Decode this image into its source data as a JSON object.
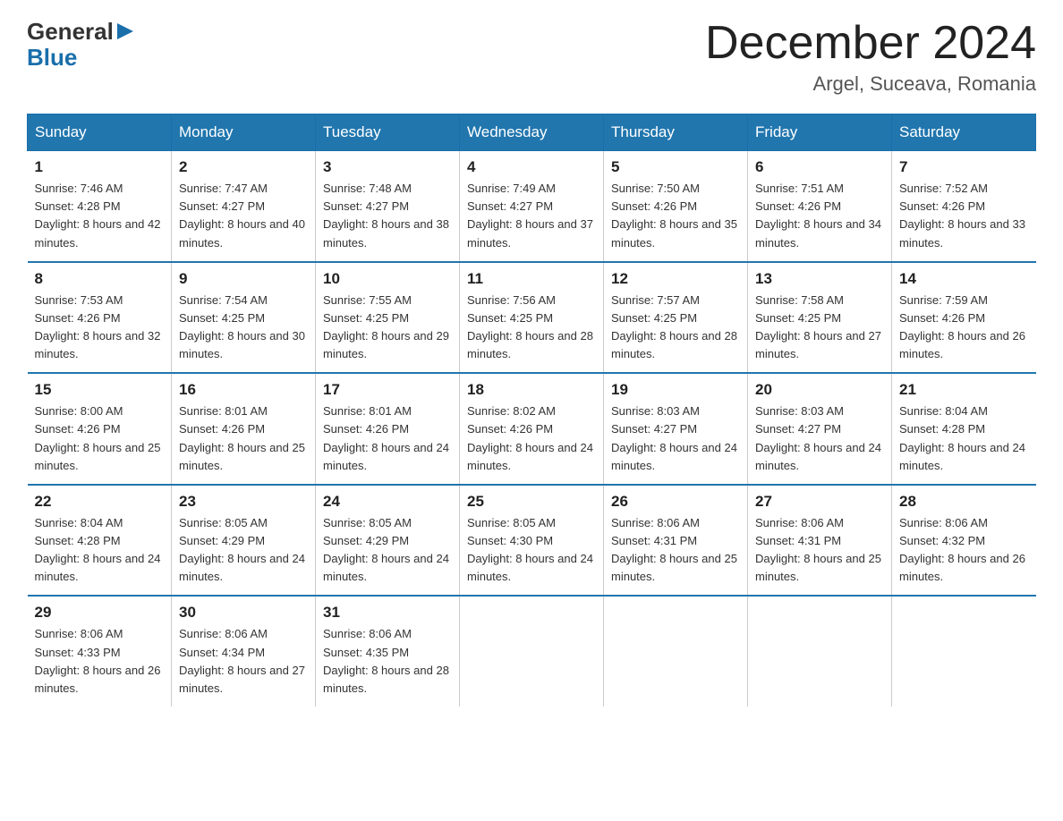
{
  "logo": {
    "line1": "General",
    "line2": "Blue"
  },
  "header": {
    "title": "December 2024",
    "location": "Argel, Suceava, Romania"
  },
  "days_of_week": [
    "Sunday",
    "Monday",
    "Tuesday",
    "Wednesday",
    "Thursday",
    "Friday",
    "Saturday"
  ],
  "weeks": [
    [
      {
        "day": "1",
        "sunrise": "7:46 AM",
        "sunset": "4:28 PM",
        "daylight": "8 hours and 42 minutes."
      },
      {
        "day": "2",
        "sunrise": "7:47 AM",
        "sunset": "4:27 PM",
        "daylight": "8 hours and 40 minutes."
      },
      {
        "day": "3",
        "sunrise": "7:48 AM",
        "sunset": "4:27 PM",
        "daylight": "8 hours and 38 minutes."
      },
      {
        "day": "4",
        "sunrise": "7:49 AM",
        "sunset": "4:27 PM",
        "daylight": "8 hours and 37 minutes."
      },
      {
        "day": "5",
        "sunrise": "7:50 AM",
        "sunset": "4:26 PM",
        "daylight": "8 hours and 35 minutes."
      },
      {
        "day": "6",
        "sunrise": "7:51 AM",
        "sunset": "4:26 PM",
        "daylight": "8 hours and 34 minutes."
      },
      {
        "day": "7",
        "sunrise": "7:52 AM",
        "sunset": "4:26 PM",
        "daylight": "8 hours and 33 minutes."
      }
    ],
    [
      {
        "day": "8",
        "sunrise": "7:53 AM",
        "sunset": "4:26 PM",
        "daylight": "8 hours and 32 minutes."
      },
      {
        "day": "9",
        "sunrise": "7:54 AM",
        "sunset": "4:25 PM",
        "daylight": "8 hours and 30 minutes."
      },
      {
        "day": "10",
        "sunrise": "7:55 AM",
        "sunset": "4:25 PM",
        "daylight": "8 hours and 29 minutes."
      },
      {
        "day": "11",
        "sunrise": "7:56 AM",
        "sunset": "4:25 PM",
        "daylight": "8 hours and 28 minutes."
      },
      {
        "day": "12",
        "sunrise": "7:57 AM",
        "sunset": "4:25 PM",
        "daylight": "8 hours and 28 minutes."
      },
      {
        "day": "13",
        "sunrise": "7:58 AM",
        "sunset": "4:25 PM",
        "daylight": "8 hours and 27 minutes."
      },
      {
        "day": "14",
        "sunrise": "7:59 AM",
        "sunset": "4:26 PM",
        "daylight": "8 hours and 26 minutes."
      }
    ],
    [
      {
        "day": "15",
        "sunrise": "8:00 AM",
        "sunset": "4:26 PM",
        "daylight": "8 hours and 25 minutes."
      },
      {
        "day": "16",
        "sunrise": "8:01 AM",
        "sunset": "4:26 PM",
        "daylight": "8 hours and 25 minutes."
      },
      {
        "day": "17",
        "sunrise": "8:01 AM",
        "sunset": "4:26 PM",
        "daylight": "8 hours and 24 minutes."
      },
      {
        "day": "18",
        "sunrise": "8:02 AM",
        "sunset": "4:26 PM",
        "daylight": "8 hours and 24 minutes."
      },
      {
        "day": "19",
        "sunrise": "8:03 AM",
        "sunset": "4:27 PM",
        "daylight": "8 hours and 24 minutes."
      },
      {
        "day": "20",
        "sunrise": "8:03 AM",
        "sunset": "4:27 PM",
        "daylight": "8 hours and 24 minutes."
      },
      {
        "day": "21",
        "sunrise": "8:04 AM",
        "sunset": "4:28 PM",
        "daylight": "8 hours and 24 minutes."
      }
    ],
    [
      {
        "day": "22",
        "sunrise": "8:04 AM",
        "sunset": "4:28 PM",
        "daylight": "8 hours and 24 minutes."
      },
      {
        "day": "23",
        "sunrise": "8:05 AM",
        "sunset": "4:29 PM",
        "daylight": "8 hours and 24 minutes."
      },
      {
        "day": "24",
        "sunrise": "8:05 AM",
        "sunset": "4:29 PM",
        "daylight": "8 hours and 24 minutes."
      },
      {
        "day": "25",
        "sunrise": "8:05 AM",
        "sunset": "4:30 PM",
        "daylight": "8 hours and 24 minutes."
      },
      {
        "day": "26",
        "sunrise": "8:06 AM",
        "sunset": "4:31 PM",
        "daylight": "8 hours and 25 minutes."
      },
      {
        "day": "27",
        "sunrise": "8:06 AM",
        "sunset": "4:31 PM",
        "daylight": "8 hours and 25 minutes."
      },
      {
        "day": "28",
        "sunrise": "8:06 AM",
        "sunset": "4:32 PM",
        "daylight": "8 hours and 26 minutes."
      }
    ],
    [
      {
        "day": "29",
        "sunrise": "8:06 AM",
        "sunset": "4:33 PM",
        "daylight": "8 hours and 26 minutes."
      },
      {
        "day": "30",
        "sunrise": "8:06 AM",
        "sunset": "4:34 PM",
        "daylight": "8 hours and 27 minutes."
      },
      {
        "day": "31",
        "sunrise": "8:06 AM",
        "sunset": "4:35 PM",
        "daylight": "8 hours and 28 minutes."
      },
      null,
      null,
      null,
      null
    ]
  ]
}
